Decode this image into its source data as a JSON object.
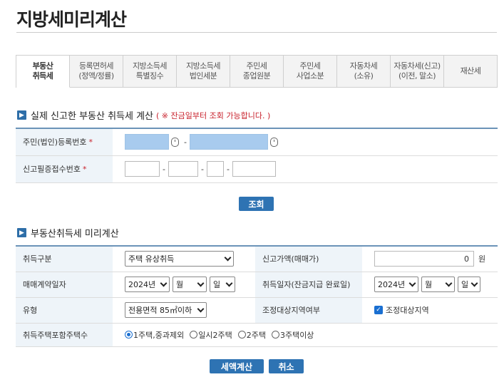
{
  "page_title": "지방세미리계산",
  "tabs": [
    {
      "label": "부동산\n취득세",
      "active": true
    },
    {
      "label": "등록면허세\n(정액/정률)",
      "active": false
    },
    {
      "label": "지방소득세\n특별징수",
      "active": false
    },
    {
      "label": "지방소득세\n법인세분",
      "active": false
    },
    {
      "label": "주민세\n종업원분",
      "active": false
    },
    {
      "label": "주민세\n사업소분",
      "active": false
    },
    {
      "label": "자동차세\n(소유)",
      "active": false
    },
    {
      "label": "자동차세(신고)\n(이전, 말소)",
      "active": false
    },
    {
      "label": "재산세",
      "active": false
    }
  ],
  "lookup": {
    "heading": "실제 신고한 부동산 취득세 계산",
    "notice": "( ※ 잔금일부터 조회 가능합니다. )",
    "id_label": "주민(법인)등록번호",
    "receipt_label": "신고필증접수번호",
    "required_mark": "*",
    "dash": "-",
    "button": "조회"
  },
  "calc": {
    "heading": "부동산취득세 미리계산",
    "acq_type_label": "취득구분",
    "acq_type_value": "주택 유상취득",
    "declared_price_label": "신고가액(매매가)",
    "declared_price_value": "0",
    "unit": "원",
    "contract_date_label": "매매계약일자",
    "acq_date_label": "취득일자(잔금지급 완료일)",
    "year_value": "2024년",
    "month_value": "월",
    "day_value": "일",
    "type_label": "유형",
    "type_value": "전용면적 85㎡이하",
    "adjust_label": "조정대상지역여부",
    "adjust_checkbox_label": "조정대상지역",
    "adjust_checked": true,
    "houses_label": "취득주택포함주택수",
    "house_options": [
      {
        "label": "1주택,중과제외",
        "selected": true
      },
      {
        "label": "일시2주택",
        "selected": false
      },
      {
        "label": "2주택",
        "selected": false
      },
      {
        "label": "3주택이상",
        "selected": false
      }
    ],
    "calc_button": "세액계산",
    "cancel_button": "취소"
  },
  "colors": {
    "accent": "#2e73b3",
    "masked_input": "#a8cbee",
    "required": "#c8202b"
  }
}
